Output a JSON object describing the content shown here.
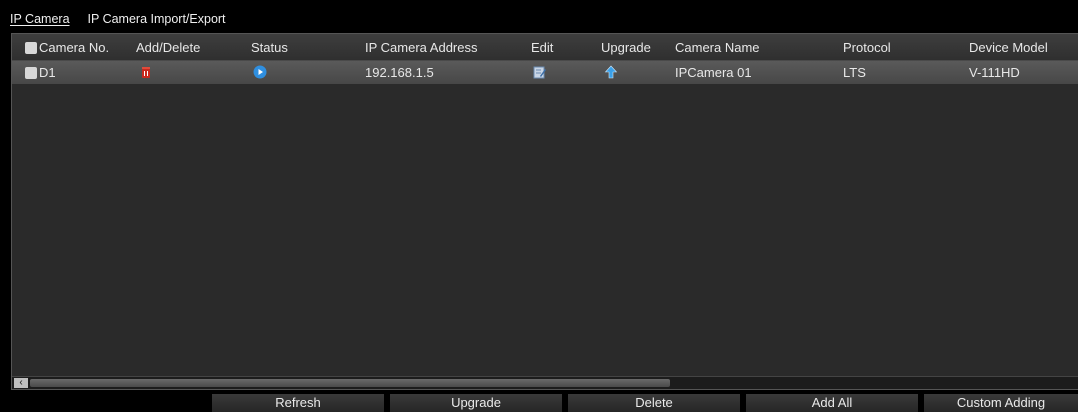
{
  "tabs": [
    {
      "label": "IP Camera",
      "active": true
    },
    {
      "label": "IP Camera Import/Export",
      "active": false
    }
  ],
  "table": {
    "columns": [
      "Camera No.",
      "Add/Delete",
      "Status",
      "IP Camera Address",
      "Edit",
      "Upgrade",
      "Camera Name",
      "Protocol",
      "Device Model"
    ],
    "rows": [
      {
        "camera_no": "D1",
        "add_delete_icon": "delete-icon",
        "status_icon": "play-status-icon",
        "ip_address": "192.168.1.5",
        "edit_icon": "edit-icon",
        "upgrade_icon": "upgrade-arrow-icon",
        "camera_name": "IPCamera 01",
        "protocol": "LTS",
        "device_model": "V-111HD"
      }
    ]
  },
  "scrollbar": {
    "left_arrow": "‹"
  },
  "buttons": {
    "refresh": "Refresh",
    "upgrade": "Upgrade",
    "delete": "Delete",
    "add_all": "Add All",
    "custom_adding": "Custom Adding"
  },
  "colors": {
    "background": "#000000",
    "panel": "#2a2a2a",
    "selected_row": "#4f4f4f",
    "delete_red": "#c8281e",
    "status_blue": "#2f8fe0"
  }
}
